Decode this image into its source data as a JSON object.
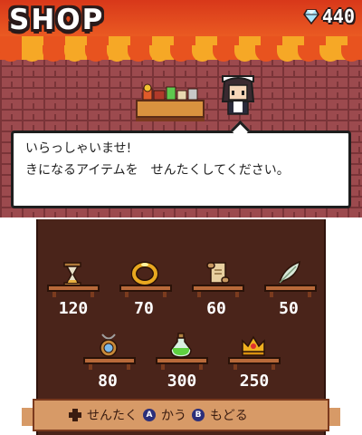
{
  "header": {
    "title": "SHOP",
    "gem_icon": "diamond-icon",
    "gem_count": "440"
  },
  "shopkeeper": {
    "icon": "maid-shopkeeper-sprite"
  },
  "dialog": {
    "line1": "いらっしゃいませ!",
    "line2": "きになるアイテムを　せんたくしてください。"
  },
  "items": [
    {
      "icon": "hourglass-icon",
      "price": "120"
    },
    {
      "icon": "gold-ring-icon",
      "price": "70"
    },
    {
      "icon": "scroll-icon",
      "price": "60"
    },
    {
      "icon": "feather-icon",
      "price": "50"
    },
    {
      "icon": "amulet-icon",
      "price": "80"
    },
    {
      "icon": "green-potion-icon",
      "price": "300"
    },
    {
      "icon": "crown-icon",
      "price": "250"
    }
  ],
  "controls": {
    "select": "せんたく",
    "buy_button": "A",
    "buy": "かう",
    "back_button": "B",
    "back": "もどる"
  },
  "colors": {
    "awning_red": "#e8531f",
    "awning_orange": "#f6a826",
    "brick": "#9c4a4e",
    "room": "#4a241a"
  }
}
